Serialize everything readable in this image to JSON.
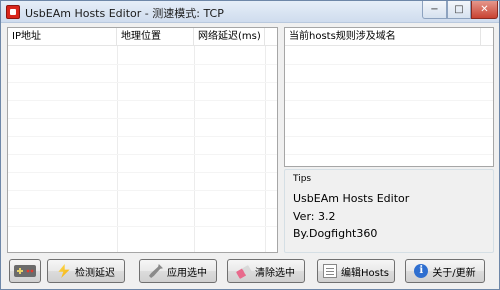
{
  "window": {
    "title": "UsbEAm Hosts Editor - 测速模式: TCP",
    "controls": {
      "minimize": "−",
      "maximize": "□",
      "close": "✕"
    }
  },
  "left_list": {
    "columns": [
      "IP地址",
      "地理位置",
      "网络延迟(ms)"
    ],
    "rows": []
  },
  "right_list": {
    "columns": [
      "当前hosts规则涉及域名"
    ],
    "rows": []
  },
  "tips": {
    "title": "Tips",
    "app_name": "UsbEAm Hosts Editor",
    "version": "Ver: 3.2",
    "author": "By.Dogfight360"
  },
  "buttons": {
    "check_latency": "检测延迟",
    "apply_selected": "应用选中",
    "clear_selected": "清除选中",
    "edit_hosts": "编辑Hosts",
    "about_update": "关于/更新"
  },
  "icons": {
    "add": "add-row-icon",
    "check": "lightning-icon",
    "apply": "wrench-icon",
    "clear": "eraser-icon",
    "edit": "document-icon",
    "about": "info-icon"
  }
}
